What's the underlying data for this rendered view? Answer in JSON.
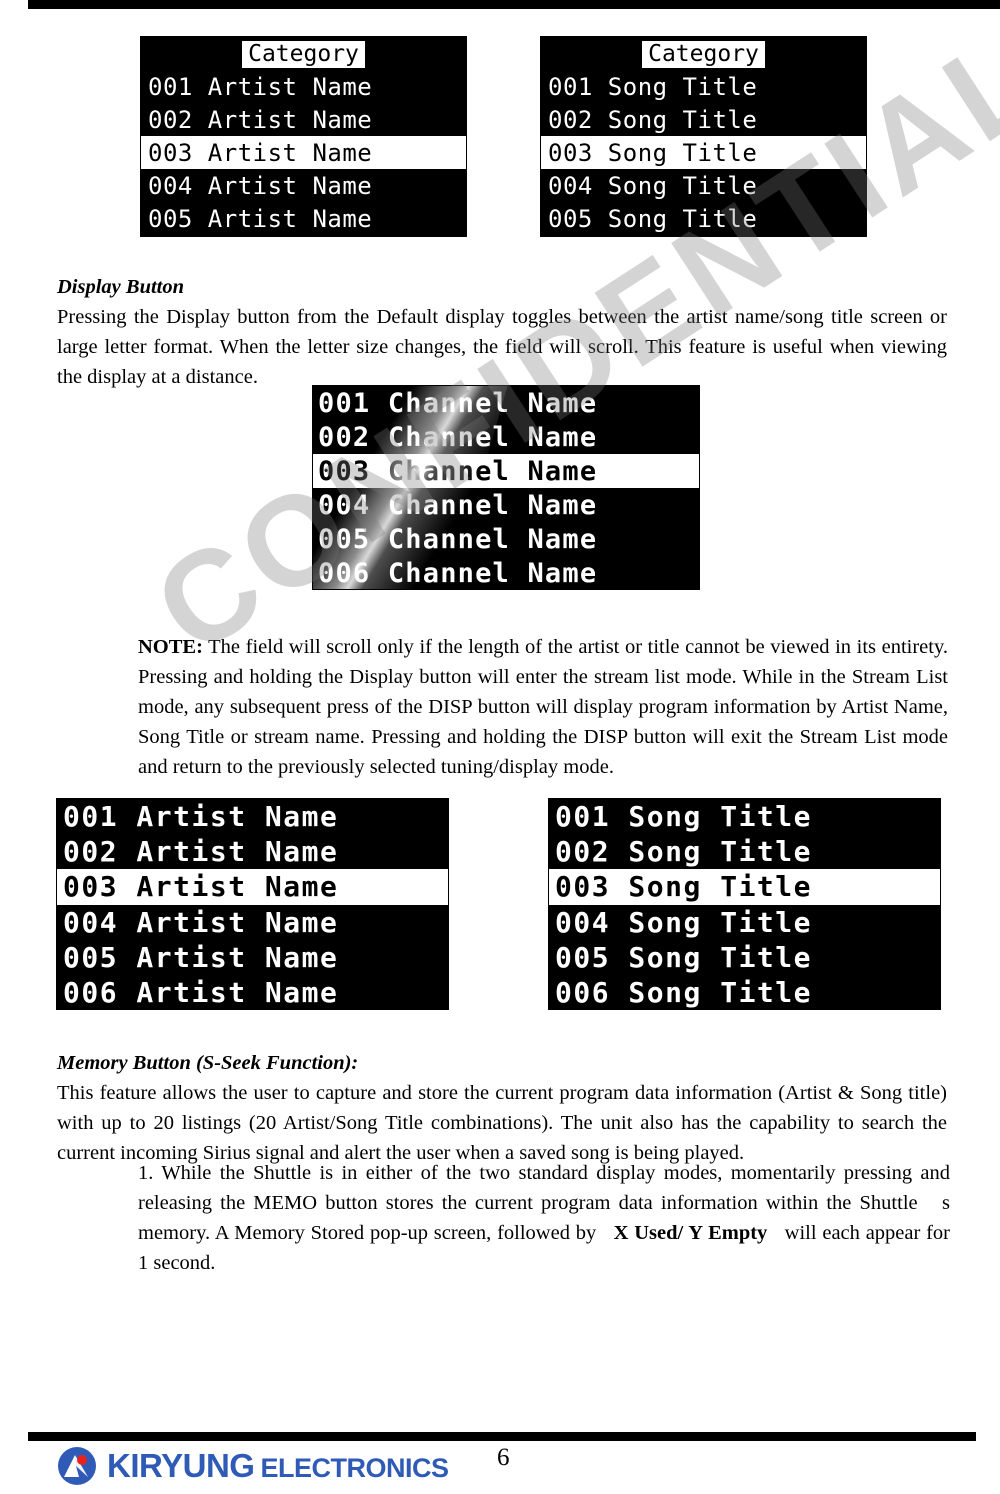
{
  "document": {
    "page_number": "6"
  },
  "displays": {
    "category_label": "Category",
    "top_artist": {
      "name": "category-artist-list",
      "header": "Category",
      "rows": [
        {
          "num": "001",
          "text": "Artist Name",
          "selected": false
        },
        {
          "num": "002",
          "text": "Artist Name",
          "selected": false
        },
        {
          "num": "003",
          "text": "Artist Name",
          "selected": true
        },
        {
          "num": "004",
          "text": "Artist Name",
          "selected": false
        },
        {
          "num": "005",
          "text": "Artist Name",
          "selected": false
        }
      ]
    },
    "top_song": {
      "name": "category-song-list",
      "header": "Category",
      "rows": [
        {
          "num": "001",
          "text": "Song Title",
          "selected": false
        },
        {
          "num": "002",
          "text": "Song Title",
          "selected": false
        },
        {
          "num": "003",
          "text": "Song Title",
          "selected": true
        },
        {
          "num": "004",
          "text": "Song Title",
          "selected": false
        },
        {
          "num": "005",
          "text": "Song Title",
          "selected": false
        }
      ]
    },
    "channel": {
      "name": "channel-name-list",
      "rows": [
        {
          "num": "001",
          "text": "Channel Name",
          "selected": false
        },
        {
          "num": "002",
          "text": "Channel Name",
          "selected": false
        },
        {
          "num": "003",
          "text": "Channel Name",
          "selected": true
        },
        {
          "num": "004",
          "text": "Channel Name",
          "selected": false
        },
        {
          "num": "005",
          "text": "Channel Name",
          "selected": false
        },
        {
          "num": "006",
          "text": "Channel Name",
          "selected": false
        }
      ]
    },
    "bottom_artist": {
      "name": "large-artist-list",
      "rows": [
        {
          "num": "001",
          "text": "Artist Name",
          "selected": false
        },
        {
          "num": "002",
          "text": "Artist Name",
          "selected": false
        },
        {
          "num": "003",
          "text": "Artist Name",
          "selected": true
        },
        {
          "num": "004",
          "text": "Artist Name",
          "selected": false
        },
        {
          "num": "005",
          "text": "Artist Name",
          "selected": false
        },
        {
          "num": "006",
          "text": "Artist Name",
          "selected": false
        }
      ]
    },
    "bottom_song": {
      "name": "large-song-list",
      "rows": [
        {
          "num": "001",
          "text": "Song Title",
          "selected": false
        },
        {
          "num": "002",
          "text": "Song Title",
          "selected": false
        },
        {
          "num": "003",
          "text": "Song Title",
          "selected": true
        },
        {
          "num": "004",
          "text": "Song Title",
          "selected": false
        },
        {
          "num": "005",
          "text": "Song Title",
          "selected": false
        },
        {
          "num": "006",
          "text": "Song Title",
          "selected": false
        }
      ]
    }
  },
  "sections": {
    "display_button": {
      "heading": "Display Button",
      "body": "Pressing the Display button from the Default display toggles between the artist name/song title screen or large letter format. When the letter size changes, the field will scroll. This feature is useful when viewing the display at a distance."
    },
    "note": {
      "label": "NOTE:",
      "body": " The field will scroll only if the length of the artist or title cannot be viewed in its entirety. Pressing and holding the Display button will enter the stream list mode. While in the Stream List mode, any subsequent press of the DISP button will display program information by Artist Name, Song Title or stream name. Pressing and holding the DISP button will exit the Stream List mode and return to the previously selected tuning/display mode."
    },
    "memory_button": {
      "heading": "Memory Button (S-Seek Function):",
      "body": "This feature allows the user to capture and store the current program data information (Artist & Song title) with up to 20 listings (20 Artist/Song Title combinations). The unit also has the capability to search the current incoming Sirius signal and alert the user when a saved song is being played."
    },
    "step_1": {
      "part1": "1. While the Shuttle is in either of the two standard display modes, momentarily pressing and releasing the MEMO button stores the current program data information within the Shuttle",
      "part2": "s memory. A Memory Stored pop-up screen, followed by",
      "emphasis": "X Used/ Y Empty",
      "part3": "will each appear for 1 second."
    }
  },
  "watermark": {
    "text": "CONFIDENTIAL"
  },
  "footer": {
    "brand_primary": "KIRYUNG",
    "brand_secondary": "ELECTRONICS",
    "brand_color": "#2f5bb7",
    "accent_color": "#e8231f"
  }
}
